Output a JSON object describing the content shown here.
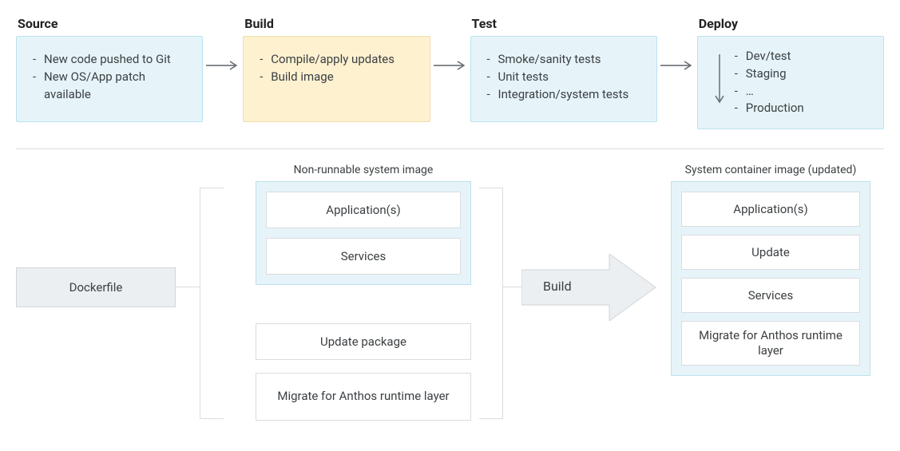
{
  "pipeline": {
    "stages": [
      {
        "title": "Source",
        "highlight": false,
        "items": [
          "New code pushed to Git",
          "New OS/App patch available"
        ]
      },
      {
        "title": "Build",
        "highlight": true,
        "items": [
          "Compile/apply updates",
          "Build image"
        ]
      },
      {
        "title": "Test",
        "highlight": false,
        "items": [
          "Smoke/sanity tests",
          "Unit tests",
          "Integration/system tests"
        ]
      },
      {
        "title": "Deploy",
        "highlight": false,
        "items": [
          "Dev/test",
          "Staging",
          "…",
          "Production"
        ]
      }
    ]
  },
  "lower": {
    "dockerfile": "Dockerfile",
    "nonRunnableCaption": "Non-runnable system image",
    "nonRunnableInner": [
      "Application(s)",
      "Services"
    ],
    "extraBlocks": [
      "Update package",
      "Migrate for Anthos runtime layer"
    ],
    "buildLabel": "Build",
    "updatedCaption": "System container image (updated)",
    "updatedInner": [
      "Application(s)",
      "Update",
      "Services",
      "Migrate for Anthos runtime layer"
    ]
  }
}
